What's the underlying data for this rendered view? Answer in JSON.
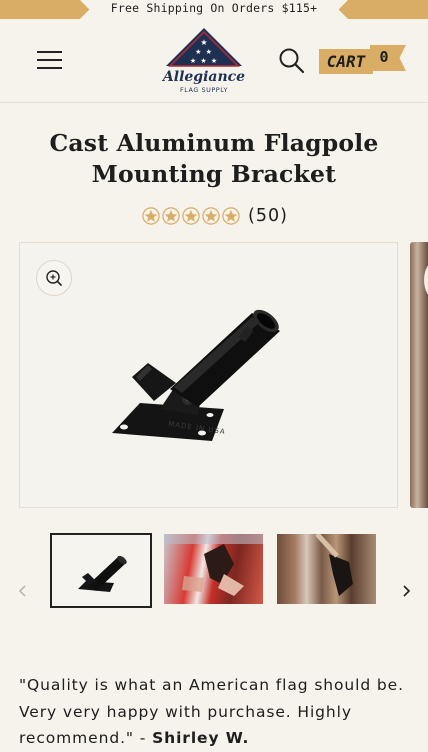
{
  "announcement": {
    "text": "Free Shipping On Orders $115+"
  },
  "header": {
    "logo": {
      "brand": "Allegiance",
      "tagline": "FLAG SUPPLY"
    },
    "cart": {
      "label": "CART",
      "count": "0"
    },
    "icons": {
      "menu": "hamburger-menu-icon",
      "search": "search-icon",
      "zoom": "zoom-in-icon"
    }
  },
  "product": {
    "title": "Cast Aluminum Flagpole Mounting Bracket",
    "rating": {
      "stars": 5,
      "count_text": "(50)"
    },
    "image_stamp": "MADE IN USA"
  },
  "gallery": {
    "thumbnails": [
      {
        "name": "bracket-product",
        "selected": true
      },
      {
        "name": "bracket-with-flag",
        "selected": false
      },
      {
        "name": "bracket-on-wood",
        "selected": false
      }
    ]
  },
  "review": {
    "quote": "\"Quality is what an American flag should be. Very very happy with purchase. Highly recommend.\" - ",
    "author": "Shirley W."
  },
  "colors": {
    "accent": "#d9ad66",
    "background": "#f6f3ec",
    "text": "#1e1e1e",
    "star": "#d9ad66",
    "logo_navy": "#1f3153",
    "logo_red": "#b52a33"
  }
}
